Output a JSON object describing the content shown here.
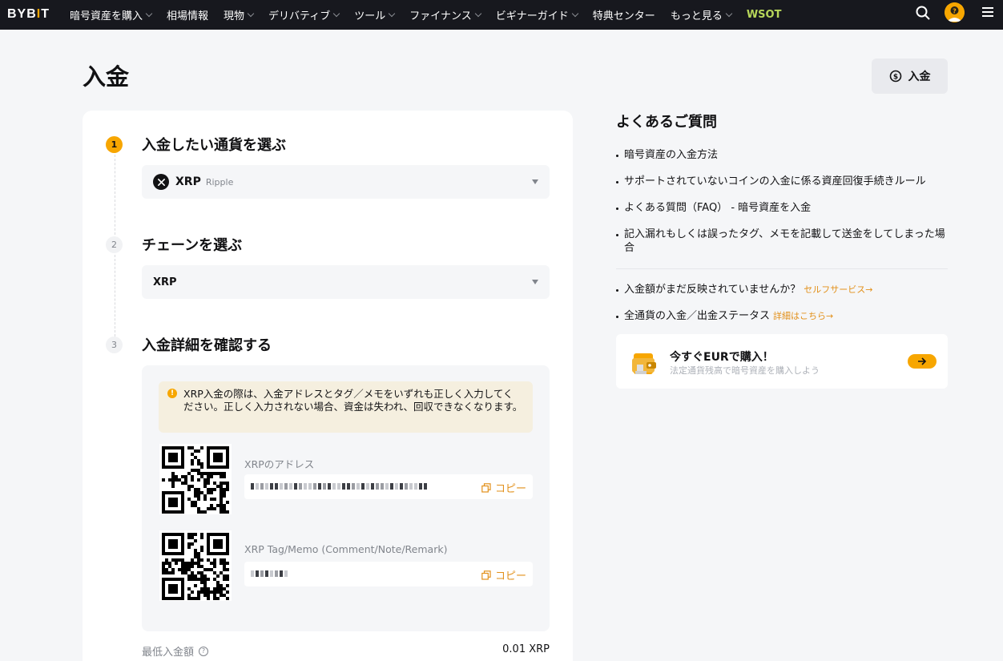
{
  "nav": {
    "logo": "BYBIT",
    "items": [
      {
        "label": "暗号資産を購入",
        "dropdown": true
      },
      {
        "label": "相場情報",
        "dropdown": false
      },
      {
        "label": "現物",
        "dropdown": true
      },
      {
        "label": "デリバティブ",
        "dropdown": true
      },
      {
        "label": "ツール",
        "dropdown": true
      },
      {
        "label": "ファイナンス",
        "dropdown": true
      },
      {
        "label": "ビギナーガイド",
        "dropdown": true
      },
      {
        "label": "特典センター",
        "dropdown": false
      },
      {
        "label": "もっと見る",
        "dropdown": true
      },
      {
        "label": "WSOT",
        "dropdown": false
      }
    ],
    "icons": [
      "search-icon",
      "avatar",
      "menu-icon"
    ]
  },
  "page": {
    "title": "入金",
    "deposit_button": "入金"
  },
  "steps": [
    {
      "number": "1",
      "title": "入金したい通貨を選ぶ"
    },
    {
      "number": "2",
      "title": "チェーンを選ぶ"
    },
    {
      "number": "3",
      "title": "入金詳細を確認する"
    }
  ],
  "coin": {
    "symbol": "XRP",
    "name": "Ripple"
  },
  "chain": {
    "value": "XRP"
  },
  "details": {
    "warning": "XRP入金の際は、入金アドレスとタグ／メモをいずれも正しく入力してください。正しく入力されない場合、資金は失われ、回収できなくなります。",
    "address_label": "XRPのアドレス",
    "tag_label": "XRP Tag/Memo (Comment/Note/Remark)",
    "copy_label": "コピー",
    "min_deposit_label": "最低入金額",
    "min_deposit_value": "0.01 XRP"
  },
  "faq": {
    "title": "よくあるご質問",
    "items": [
      "暗号資産の入金方法",
      "サポートされていないコインの入金に係る資産回復手続きルール",
      "よくある質問（FAQ） - 暗号資産を入金",
      "記入漏れもしくは誤ったタグ、メモを記載して送金をしてしまった場合"
    ],
    "status_items": [
      {
        "text": "入金額がまだ反映されていませんか？",
        "link": "セルフサービス→"
      },
      {
        "text": "全通貨の入金／出金ステータス",
        "link": "詳細はこちら→"
      }
    ]
  },
  "buy_card": {
    "title": "今すぐEURで購入！",
    "subtitle": "法定通貨残高で暗号資産を購入しよう"
  },
  "colors": {
    "accent": "#f7a600",
    "link": "#e2901a",
    "nav_bg": "#17181e",
    "wsot": "#b7d65a"
  }
}
